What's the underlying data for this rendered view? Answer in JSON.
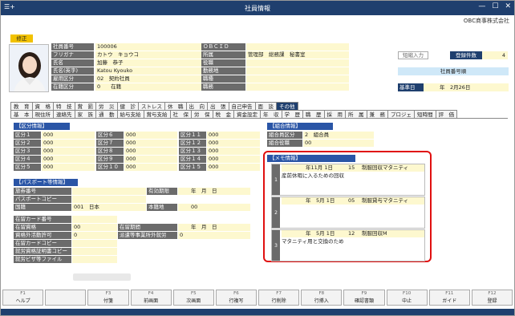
{
  "window": {
    "title": "社員情報",
    "menu_icon": "☰+",
    "controls": [
      "—",
      "☐",
      "✕"
    ],
    "company": "OBC商事株式会社"
  },
  "mode_badge": "修正",
  "basic": {
    "rows": [
      {
        "label": "社員番号",
        "value": "100006",
        "label2": "ＯＢＣＩＤ",
        "value2": ""
      },
      {
        "label": "フリガナ",
        "value": "カトウ　キョウコ",
        "label2": "所属",
        "value2": "管理部　総務課　秘書室"
      },
      {
        "label": "氏名",
        "value": "加藤　恭子",
        "label2": "役職",
        "value2": ""
      },
      {
        "label": "氏名(英字)",
        "value": "Katou Kyouko",
        "label2": "勤務地",
        "value2": ""
      },
      {
        "label": "雇用区分",
        "value": "02　契約社員",
        "label2": "職種",
        "value2": ""
      },
      {
        "label": "在籍区分",
        "value": "0　　在籍",
        "label2": "職務",
        "value2": ""
      }
    ]
  },
  "right_panel": {
    "short_input": "短縮入力",
    "reg_count_label": "登録件数",
    "reg_count": "4",
    "emp_no_order": "社員番号順",
    "base_date_label": "基準日",
    "base_date": "年　2月26日"
  },
  "tabs_row1": [
    "教　育",
    "資　格",
    "特　技",
    "賞　罰",
    "労　災",
    "健　診",
    "ストレス",
    "休　職",
    "出　向",
    "出　張",
    "自己申告",
    "面　談",
    "その他"
  ],
  "tabs_row2": [
    "基　本",
    "現住所",
    "連絡先",
    "家　族",
    "通　勤",
    "給与支給",
    "賞与支給",
    "社　保",
    "労　保",
    "税　金",
    "資金設定",
    "年　収",
    "学　歴",
    "職　歴",
    "採　用",
    "所　属",
    "兼　務",
    "プロジェ",
    "短時間",
    "評　価"
  ],
  "kubun": {
    "title": "【区分情報】",
    "items": [
      {
        "label": "区分１",
        "value": "000"
      },
      {
        "label": "区分２",
        "value": "000"
      },
      {
        "label": "区分３",
        "value": "000"
      },
      {
        "label": "区分４",
        "value": "000"
      },
      {
        "label": "区分５",
        "value": "000"
      },
      {
        "label": "区分６",
        "value": "000"
      },
      {
        "label": "区分７",
        "value": "000"
      },
      {
        "label": "区分８",
        "value": "000"
      },
      {
        "label": "区分９",
        "value": "000"
      },
      {
        "label": "区分１０",
        "value": "000"
      },
      {
        "label": "区分１１",
        "value": "000"
      },
      {
        "label": "区分１２",
        "value": "000"
      },
      {
        "label": "区分１３",
        "value": "000"
      },
      {
        "label": "区分１４",
        "value": "000"
      },
      {
        "label": "区分１５",
        "value": "000"
      }
    ]
  },
  "kumiai": {
    "title": "【組合情報】",
    "rows": [
      {
        "label": "組合員区分",
        "value": "2　組合員"
      },
      {
        "label": "組合役職",
        "value": "00"
      }
    ]
  },
  "passport": {
    "title": "【パスポート等情報】",
    "rows": [
      {
        "label": "旅券番号",
        "value": "",
        "label2": "有効期限",
        "value2": "年　月　日"
      },
      {
        "label": "パスポートコピー",
        "value": "",
        "label2": "",
        "value2": ""
      },
      {
        "label": "国籍",
        "value": "001　日本",
        "label2": "本籍地",
        "value2": "00"
      }
    ]
  },
  "zairyu": {
    "rows": [
      {
        "label": "在留カード番号",
        "value": "",
        "label2": "",
        "value2": ""
      },
      {
        "label": "在留資格",
        "value": "00",
        "label2": "在留期間",
        "value2": "年　月　日"
      },
      {
        "label": "資格外活動許可",
        "value": "0",
        "label2": "派遣等事業所外就労",
        "value2": "0"
      },
      {
        "label": "在留カードコピー",
        "value": "",
        "label2": "",
        "value2": ""
      },
      {
        "label": "就労資格証明書コピー",
        "value": "",
        "label2": "",
        "value2": ""
      },
      {
        "label": "就労ビザ等ファイル",
        "value": "",
        "label2": "",
        "value2": ""
      }
    ]
  },
  "memo": {
    "title": "【メモ情報】",
    "rows": [
      {
        "num": "1",
        "date": "年11月 1日",
        "code": "15",
        "type": "制服回収マタニティ",
        "text": "産前休暇に入るための回収"
      },
      {
        "num": "2",
        "date": "年　5月 1日",
        "code": "05",
        "type": "制服貸与マタニティ",
        "text": ""
      },
      {
        "num": "3",
        "date": "年　5月 1日",
        "code": "12",
        "type": "制服回収M",
        "text": "マタニティ用と交換のため"
      }
    ]
  },
  "fkeys": [
    {
      "key": "F1",
      "label": "ヘルプ"
    },
    {
      "key": "",
      "label": ""
    },
    {
      "key": "F3",
      "label": "付箋"
    },
    {
      "key": "F4",
      "label": "前画面"
    },
    {
      "key": "F5",
      "label": "次画面"
    },
    {
      "key": "F6",
      "label": "行複写"
    },
    {
      "key": "F7",
      "label": "行削除"
    },
    {
      "key": "F8",
      "label": "行挿入"
    },
    {
      "key": "F9",
      "label": "確認書類"
    },
    {
      "key": "F10",
      "label": "中止"
    },
    {
      "key": "F11",
      "label": "ガイド"
    },
    {
      "key": "F12",
      "label": "登録"
    }
  ]
}
